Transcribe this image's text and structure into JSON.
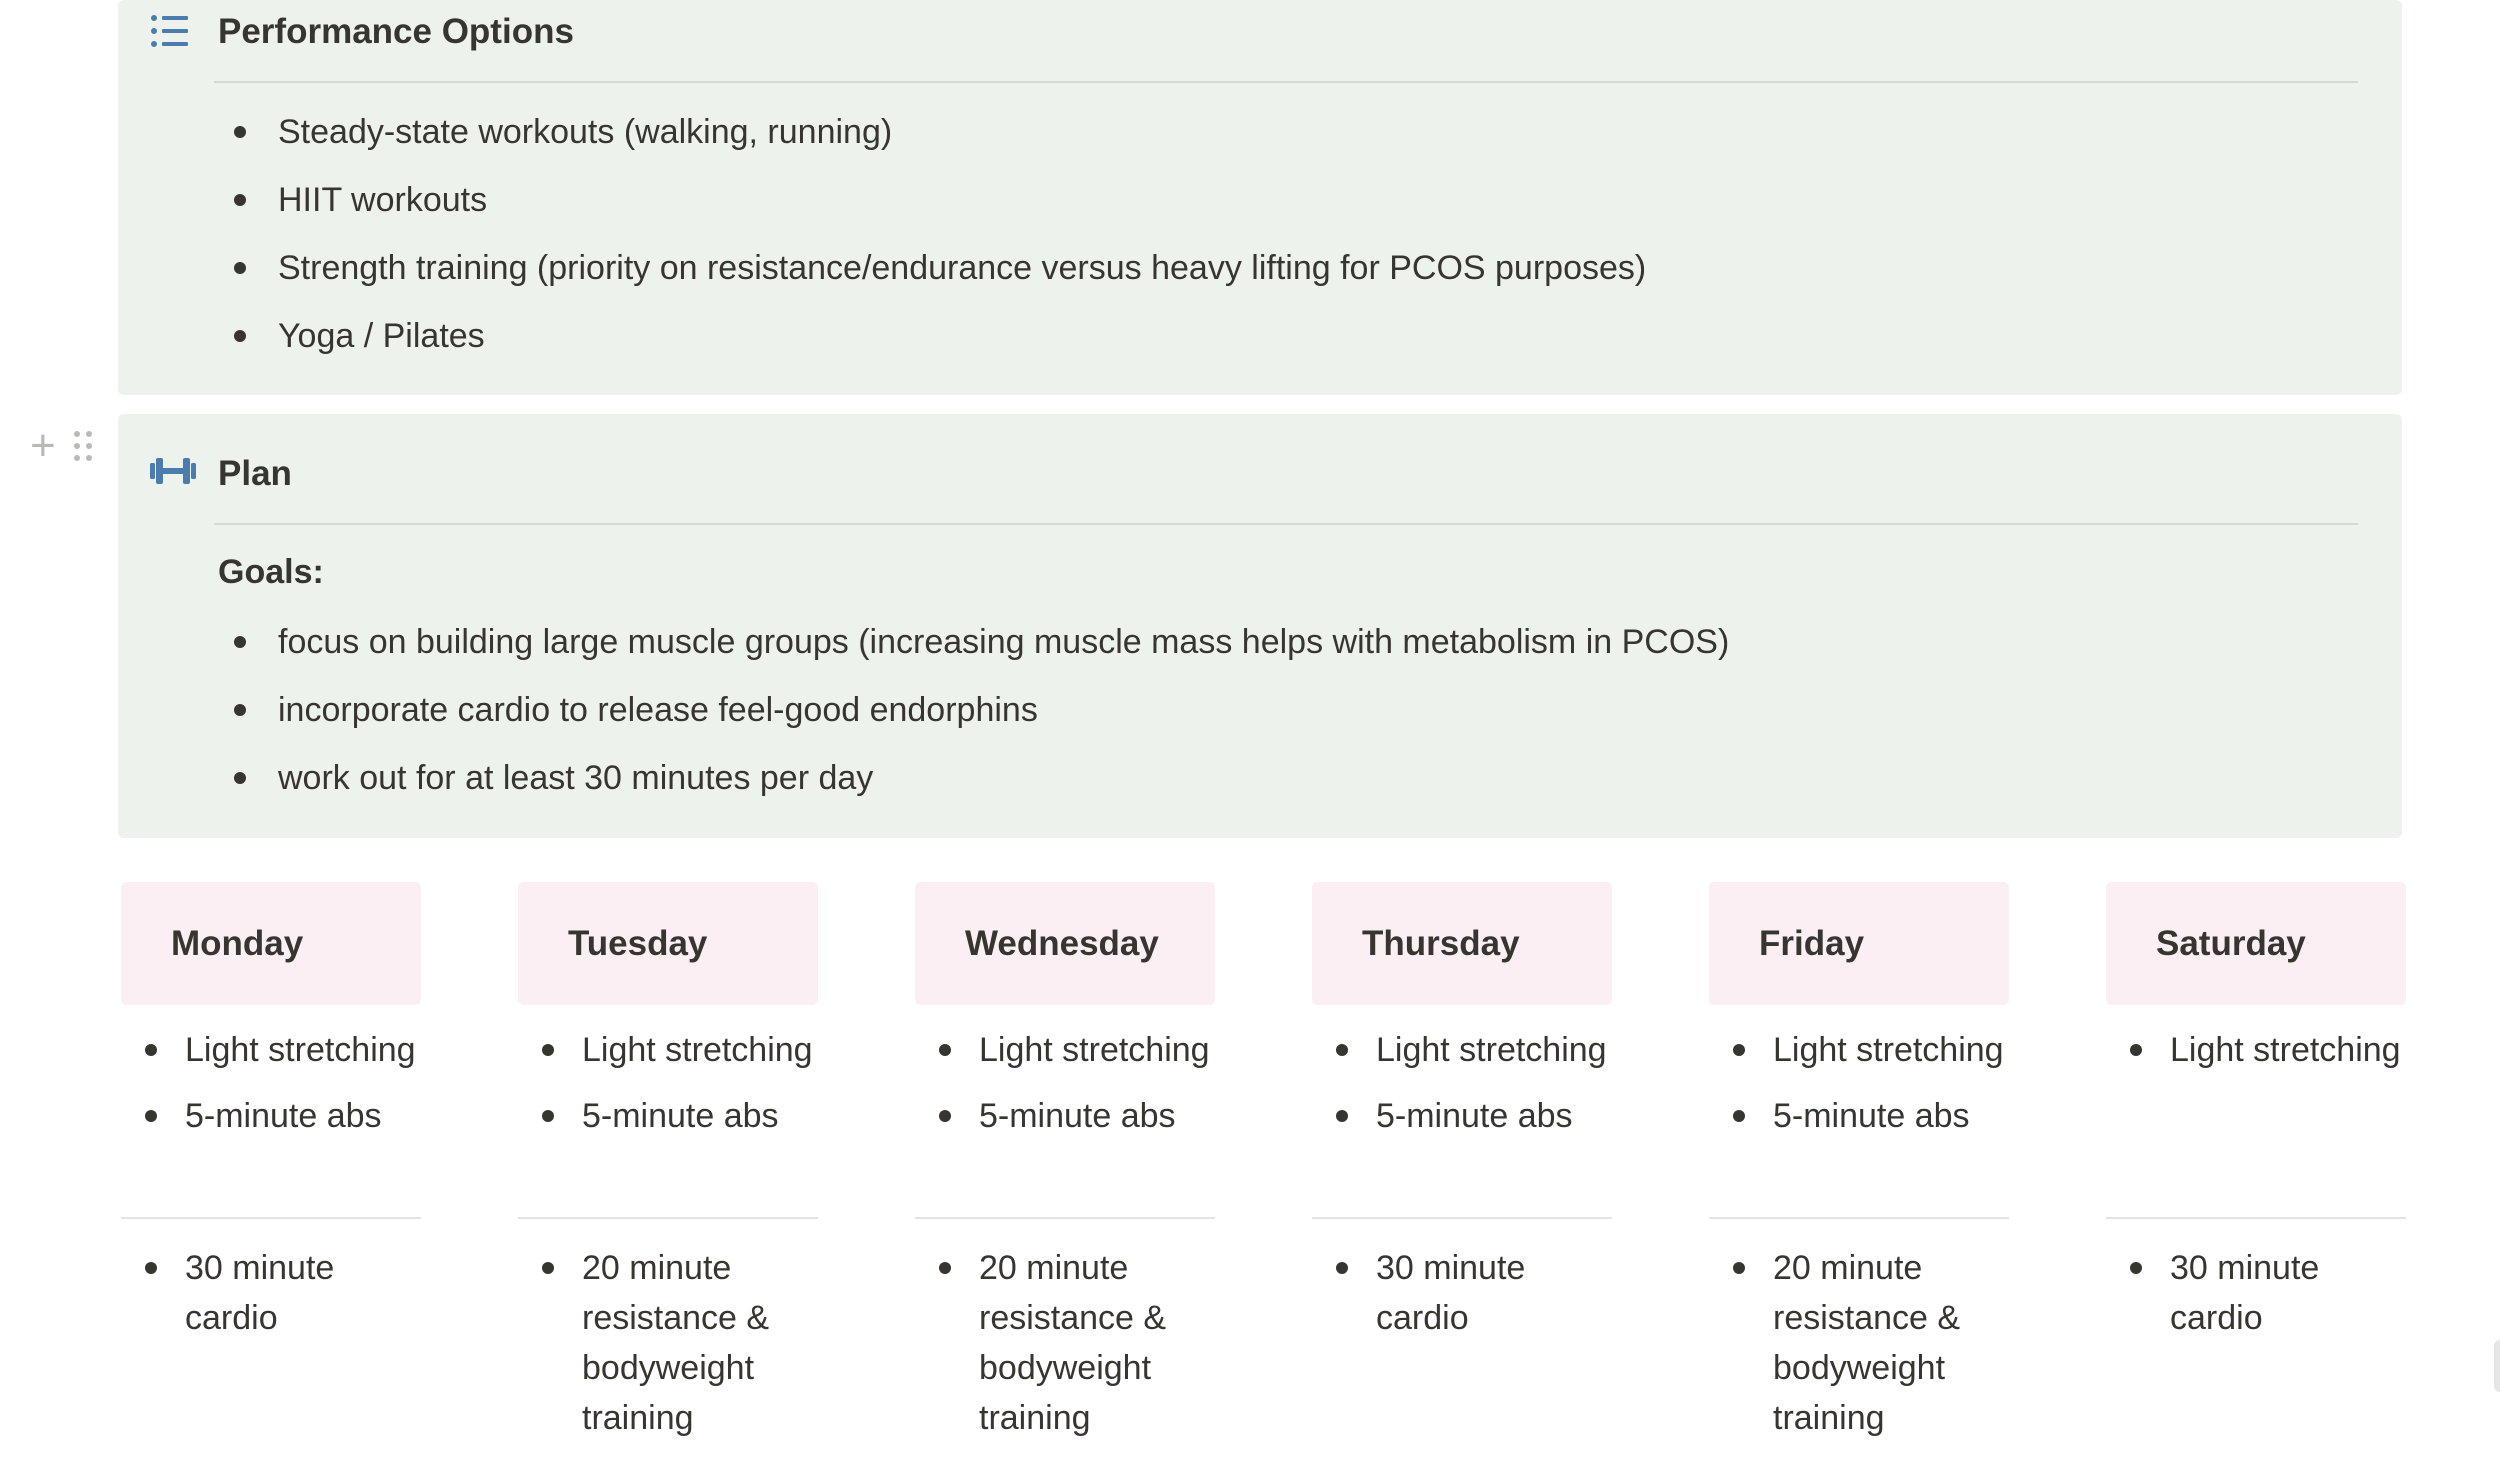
{
  "performance_callout": {
    "icon": "bulleted-list-icon",
    "title": "Performance Options",
    "items": [
      "Steady-state workouts (walking, running)",
      "HIIT workouts",
      "Strength training (priority on resistance/endurance versus heavy lifting for PCOS purposes)",
      "Yoga / Pilates"
    ]
  },
  "plan_callout": {
    "icon": "dumbbell-icon",
    "title": "Plan",
    "goals_label": "Goals:",
    "goals": [
      "focus on building large muscle groups (increasing muscle mass helps with metabolism in PCOS)",
      "incorporate cardio to release feel-good endorphins",
      "work out for at least 30 minutes per day"
    ]
  },
  "days": [
    {
      "name": "Monday",
      "top": [
        "Light stretching",
        "5-minute abs"
      ],
      "bottom": [
        "30 minute cardio"
      ]
    },
    {
      "name": "Tuesday",
      "top": [
        "Light stretching",
        "5-minute abs"
      ],
      "bottom": [
        "20 minute resistance & bodyweight training"
      ]
    },
    {
      "name": "Wednesday",
      "top": [
        "Light stretching",
        "5-minute abs"
      ],
      "bottom": [
        "20 minute resistance & bodyweight training"
      ]
    },
    {
      "name": "Thursday",
      "top": [
        "Light stretching",
        "5-minute abs"
      ],
      "bottom": [
        "30 minute cardio"
      ]
    },
    {
      "name": "Friday",
      "top": [
        "Light stretching",
        "5-minute abs"
      ],
      "bottom": [
        "20 minute resistance & bodyweight training"
      ]
    },
    {
      "name": "Saturday",
      "top": [
        "Light stretching"
      ],
      "bottom": [
        "30 minute cardio"
      ]
    }
  ],
  "colors": {
    "callout_bg": "#edf2ed",
    "day_header_bg": "#fbeff4",
    "icon_blue": "#4a7cae",
    "text": "#37352f"
  }
}
